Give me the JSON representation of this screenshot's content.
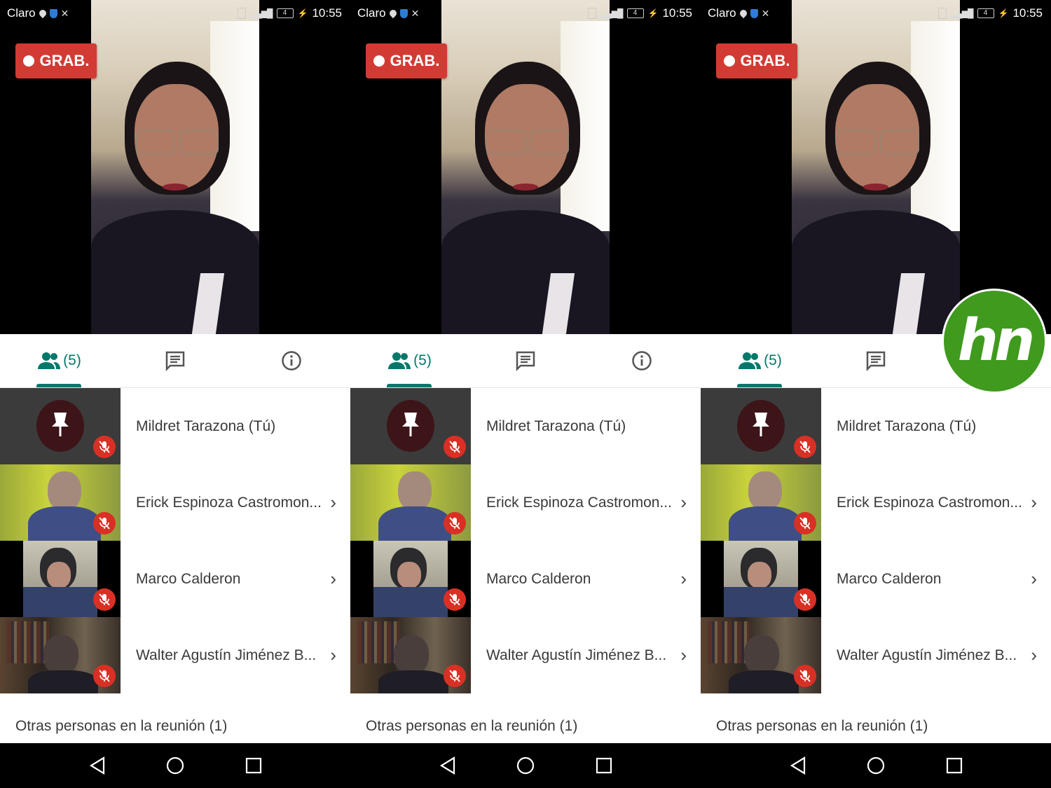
{
  "status_bar": {
    "carrier": "Claro",
    "time": "10:55",
    "battery": "4",
    "network": "4G"
  },
  "recording_badge": {
    "label": "GRAB."
  },
  "tabs": {
    "people_count": "(5)"
  },
  "participants": [
    {
      "name": "Mildret Tarazona (Tú)",
      "has_chevron": false
    },
    {
      "name": "Erick Espinoza Castromon...",
      "has_chevron": true
    },
    {
      "name": "Marco Calderon",
      "has_chevron": true
    },
    {
      "name": "Walter Agustín Jiménez B...",
      "has_chevron": true
    }
  ],
  "others_section": {
    "label": "Otras personas en la reunión (1)"
  },
  "chevron": "›",
  "logo": {
    "text": "hn"
  },
  "colors": {
    "accent": "#00796b",
    "record": "#d23b33",
    "mute": "#d93025",
    "logo": "#3f9a1e"
  }
}
